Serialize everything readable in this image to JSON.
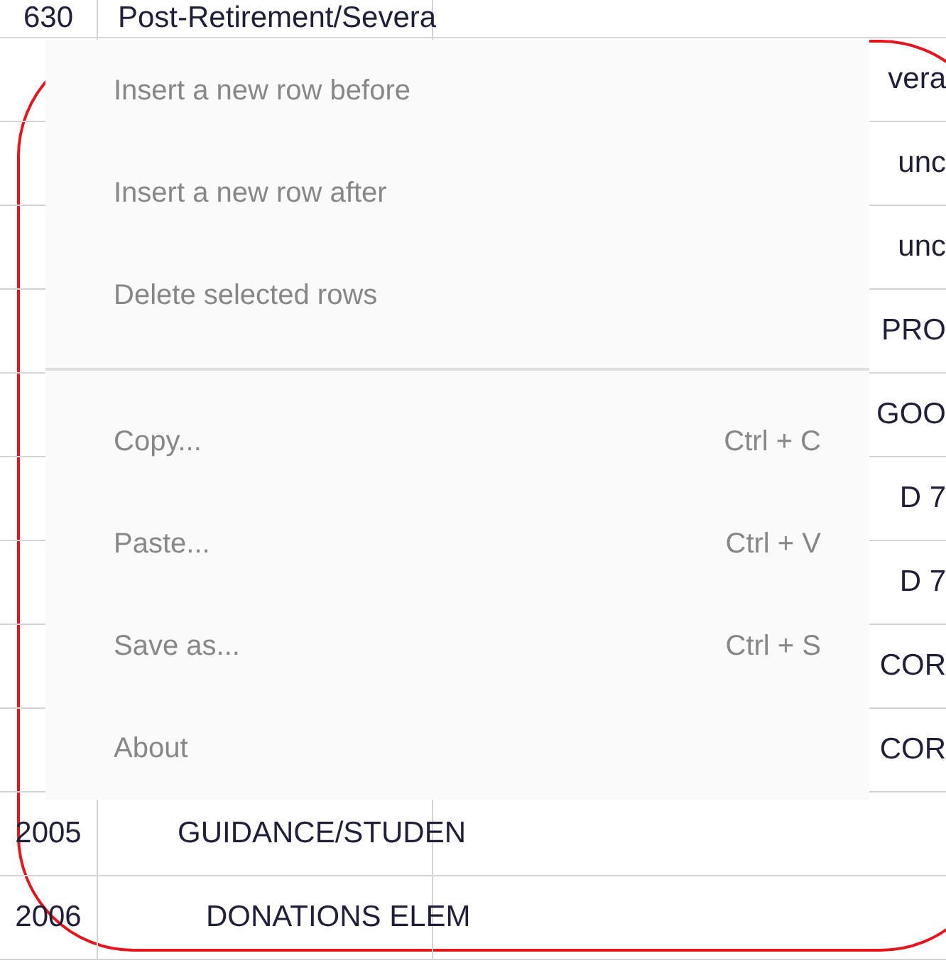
{
  "table": {
    "rows": [
      {
        "column_1": "630",
        "column_2": "Post-Retirement/Severa"
      },
      {
        "column_2": "vera"
      },
      {
        "column_2": "unc"
      },
      {
        "column_2": "unc"
      },
      {
        "column_2": "PRO"
      },
      {
        "column_2": "GOO"
      },
      {
        "column_2": "D 7"
      },
      {
        "column_2": "D 7"
      },
      {
        "column_2": "COR"
      },
      {
        "column_2": "COR"
      },
      {
        "column_1": "2005",
        "column_2": "GUIDANCE/STUDEN"
      },
      {
        "column_1": "2006",
        "column_2": "DONATIONS ELEM"
      }
    ]
  },
  "context_menu": {
    "sections": [
      [
        {
          "label": "Insert a new row before"
        },
        {
          "label": "Insert a new row after"
        },
        {
          "label": "Delete selected rows"
        }
      ],
      [
        {
          "label": "Copy...",
          "shortcut": "Ctrl + C"
        },
        {
          "label": "Paste...",
          "shortcut": "Ctrl + V"
        },
        {
          "label": "Save as...",
          "shortcut": "Ctrl + S"
        },
        {
          "label": "About"
        }
      ]
    ]
  },
  "annotation": {
    "kind": "outline"
  }
}
